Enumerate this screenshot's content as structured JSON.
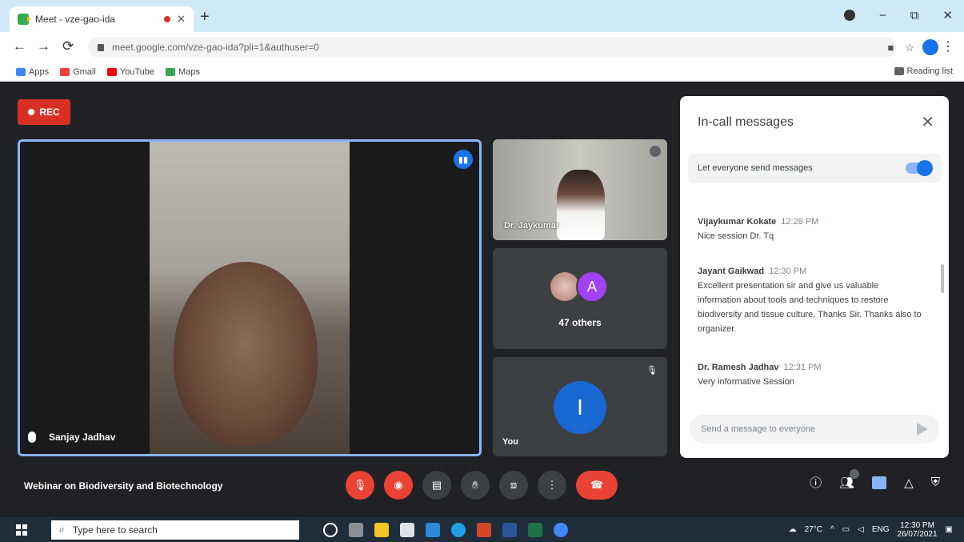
{
  "browser": {
    "tab_title": "Meet - vze-gao-ida",
    "url": "meet.google.com/vze-gao-ida?pli=1&authuser=0",
    "window_controls": [
      "−",
      "⧉",
      "✕"
    ],
    "bookmarks": [
      "Apps",
      "Gmail",
      "YouTube",
      "Maps"
    ],
    "reading_list": "Reading list"
  },
  "meet": {
    "rec_label": "REC",
    "main_speaker_name": "Sanjay Jadhav",
    "tile1_name": "Dr. Jaykumar",
    "tile2_avatar_letter": "A",
    "tile2_others": "47 others",
    "tile3_avatar_letter": "I",
    "tile3_name": "You",
    "meeting_title": "Webinar on Biodiversity and Biotechnology"
  },
  "chat": {
    "title": "In-call messages",
    "toggle_label": "Let everyone send messages",
    "messages": [
      {
        "sender": "Vijaykumar Kokate",
        "time": "12:28 PM",
        "text": "Nice session Dr. Tq"
      },
      {
        "sender": "Jayant Gaikwad",
        "time": "12:30 PM",
        "text": "Excellent presentation sir and give us valuable information about tools and techniques to restore biodiversity and tissue culture. Thanks Sir. Thanks also to organizer."
      },
      {
        "sender": "Dr. Ramesh Jadhav",
        "time": "12:31 PM",
        "text": "Very informative Session"
      }
    ],
    "input_placeholder": "Send a message to everyone"
  },
  "taskbar": {
    "search_placeholder": "Type here to search",
    "weather": "27°C",
    "lang": "ENG",
    "time": "12:30 PM",
    "date": "26/07/2021"
  },
  "colors": {
    "meet_bg": "#202124",
    "end_call": "#ea4335",
    "accent": "#1a73e8"
  }
}
